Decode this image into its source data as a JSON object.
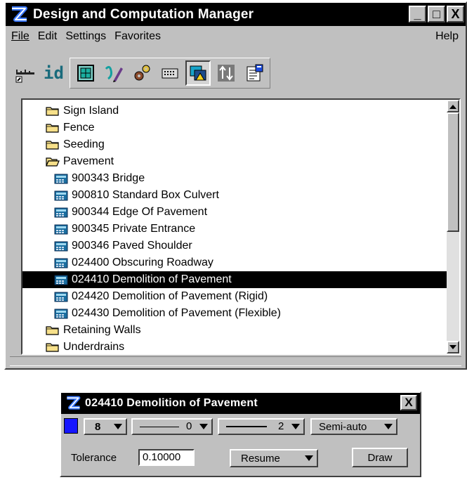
{
  "window": {
    "title": "Design and Computation Manager",
    "minimize": "_",
    "maximize": "□",
    "close": "X"
  },
  "menu": {
    "file": "File",
    "edit": "Edit",
    "settings": "Settings",
    "favorites": "Favorites",
    "help": "Help"
  },
  "toolbar": {
    "id_label": "id",
    "icons": [
      "keyin-icon",
      "id-icon",
      "place-icon",
      "draw-icon",
      "gear-icon",
      "keyboard-icon",
      "highlight-icon",
      "sort-icon",
      "properties-icon"
    ]
  },
  "tree": {
    "rows": [
      {
        "label": "Sign Island",
        "type": "folder",
        "level": 0
      },
      {
        "label": "Fence",
        "type": "folder",
        "level": 0
      },
      {
        "label": "Seeding",
        "type": "folder",
        "level": 0
      },
      {
        "label": "Pavement",
        "type": "folder-open",
        "level": 0
      },
      {
        "label": "900343 Bridge",
        "type": "item",
        "level": 1
      },
      {
        "label": "900810 Standard Box Culvert",
        "type": "item",
        "level": 1
      },
      {
        "label": "900344 Edge Of Pavement",
        "type": "item",
        "level": 1
      },
      {
        "label": "900345 Private Entrance",
        "type": "item",
        "level": 1
      },
      {
        "label": "900346 Paved Shoulder",
        "type": "item",
        "level": 1
      },
      {
        "label": "024400 Obscuring Roadway",
        "type": "item",
        "level": 1
      },
      {
        "label": "024410 Demolition of Pavement",
        "type": "item",
        "level": 1,
        "selected": true
      },
      {
        "label": "024420 Demolition of Pavement (Rigid)",
        "type": "item",
        "level": 1
      },
      {
        "label": "024430 Demolition of Pavement (Flexible)",
        "type": "item",
        "level": 1
      },
      {
        "label": "Retaining Walls",
        "type": "folder",
        "level": 0
      },
      {
        "label": "Underdrains",
        "type": "folder",
        "level": 0
      }
    ]
  },
  "dialog": {
    "title": "024410 Demolition of Pavement",
    "close": "X",
    "color": "#1515ff",
    "level": "8",
    "style": "0",
    "weight": "2",
    "mode": "Semi-auto",
    "tolerance_label": "Tolerance",
    "tolerance_value": "0.10000",
    "resume": "Resume",
    "draw": "Draw"
  }
}
